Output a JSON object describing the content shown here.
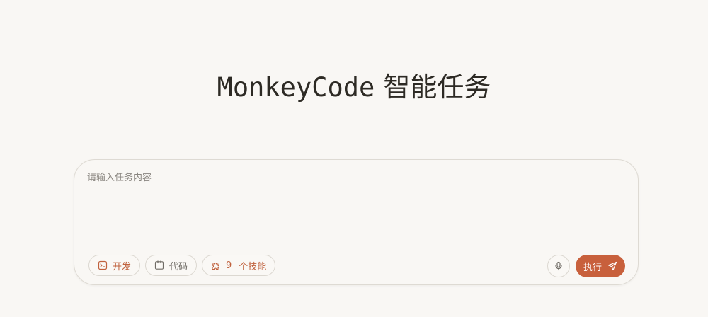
{
  "header": {
    "brand": "MonkeyCode",
    "subtitle": "智能任务"
  },
  "task_input": {
    "placeholder": "请输入任务内容",
    "value": ""
  },
  "toolbar": {
    "dev_label": "开发",
    "code_label": "代码",
    "skills_count": "9",
    "skills_label": "个技能",
    "run_label": "执行"
  },
  "icons": {
    "dev": "terminal-icon",
    "code": "code-file-icon",
    "skills": "puzzle-icon",
    "mic": "microphone-icon",
    "run": "send-icon"
  },
  "colors": {
    "background": "#f9f7f4",
    "accent": "#c8603c",
    "border": "#dcd8d1",
    "text": "#2d2a24"
  }
}
